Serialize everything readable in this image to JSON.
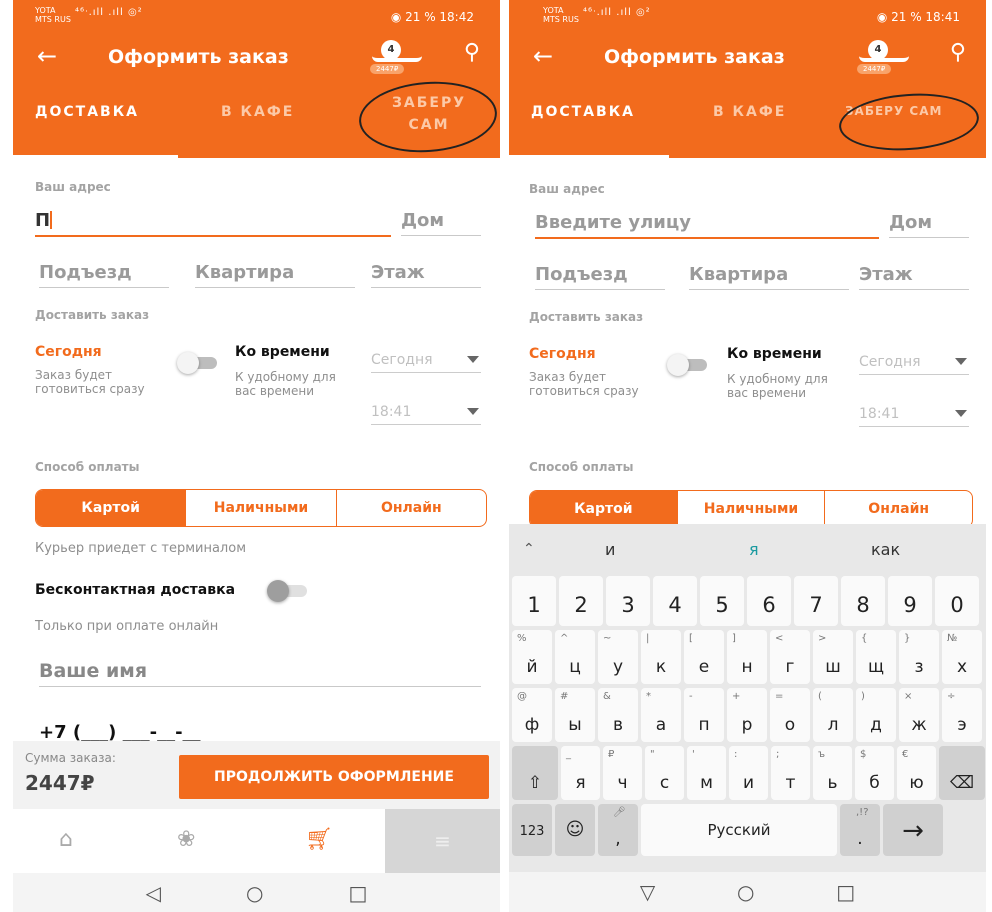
{
  "status_left": {
    "carrier1": "YOTA",
    "carrier2": "MTS RUS",
    "signal": "⁴⁶ᐧ.ıll .ıll ◎²",
    "right": "21 %  18:42"
  },
  "status_right": {
    "carrier1": "YOTA",
    "carrier2": "MTS RUS",
    "signal": "⁴⁶ᐧ.ıll .ıll ◎²",
    "right": "21 %  18:41"
  },
  "header": {
    "title": "Оформить заказ",
    "cart_count": "4",
    "cart_price": "2447₽"
  },
  "tabs": {
    "delivery": "ДОСТАВКА",
    "cafe": "В КАФЕ",
    "pickup": "ЗАБЕРУ САМ"
  },
  "form": {
    "address_label": "Ваш адрес",
    "street_value": "П",
    "street_placeholder": "Введите улицу",
    "house_placeholder": "Дом",
    "entrance_placeholder": "Подъезд",
    "flat_placeholder": "Квартира",
    "floor_placeholder": "Этаж",
    "deliver_label": "Доставить заказ",
    "today_title": "Сегодня",
    "today_desc": "Заказ будет готовиться сразу",
    "bytime_title": "Ко времени",
    "bytime_desc": "К удобному для вас времени",
    "day_select": "Сегодня",
    "time_select": "18:41",
    "payment_label": "Способ оплаты",
    "pay_card": "Картой",
    "pay_cash": "Наличными",
    "pay_online": "Онлайн",
    "courier_note": "Курьер приедет с терминалом",
    "contactless": "Бесконтактная доставка",
    "online_only": "Только при оплате онлайн",
    "name_placeholder": "Ваше имя",
    "phone_mask": "+7 (___) ___-__-__"
  },
  "summary": {
    "caption": "Сумма заказа:",
    "amount": "2447₽",
    "continue": "ПРОДОЛЖИТЬ ОФОРМЛЕНИЕ"
  },
  "keyboard": {
    "suggestions": [
      "и",
      "я",
      "как"
    ],
    "numbers": [
      "1",
      "2",
      "3",
      "4",
      "5",
      "6",
      "7",
      "8",
      "9",
      "0"
    ],
    "row1": [
      [
        "%",
        "й"
      ],
      [
        "^",
        "ц"
      ],
      [
        "~",
        "у"
      ],
      [
        "|",
        "к"
      ],
      [
        "[",
        "е"
      ],
      [
        "]",
        "н"
      ],
      [
        "<",
        "г"
      ],
      [
        ">",
        "ш"
      ],
      [
        "{",
        "щ"
      ],
      [
        "}",
        "з"
      ],
      [
        "№",
        "х"
      ]
    ],
    "row2": [
      [
        "@",
        "ф"
      ],
      [
        "#",
        "ы"
      ],
      [
        "&",
        "в"
      ],
      [
        "*",
        "а"
      ],
      [
        "-",
        "п"
      ],
      [
        "+",
        "р"
      ],
      [
        "=",
        "о"
      ],
      [
        "(",
        "л"
      ],
      [
        ")",
        "д"
      ],
      [
        "×",
        "ж"
      ],
      [
        "÷",
        "э"
      ]
    ],
    "row3": [
      [
        "_",
        "я"
      ],
      [
        "₽",
        "ч"
      ],
      [
        "\"",
        "с"
      ],
      [
        "'",
        "м"
      ],
      [
        ":",
        "и"
      ],
      [
        ";",
        "т"
      ],
      [
        "ъ",
        "ь"
      ],
      [
        "$",
        "б"
      ],
      [
        "€",
        "ю"
      ]
    ],
    "key_123": "123",
    "space_label": "Русский",
    "comma": ",",
    "period": "."
  }
}
